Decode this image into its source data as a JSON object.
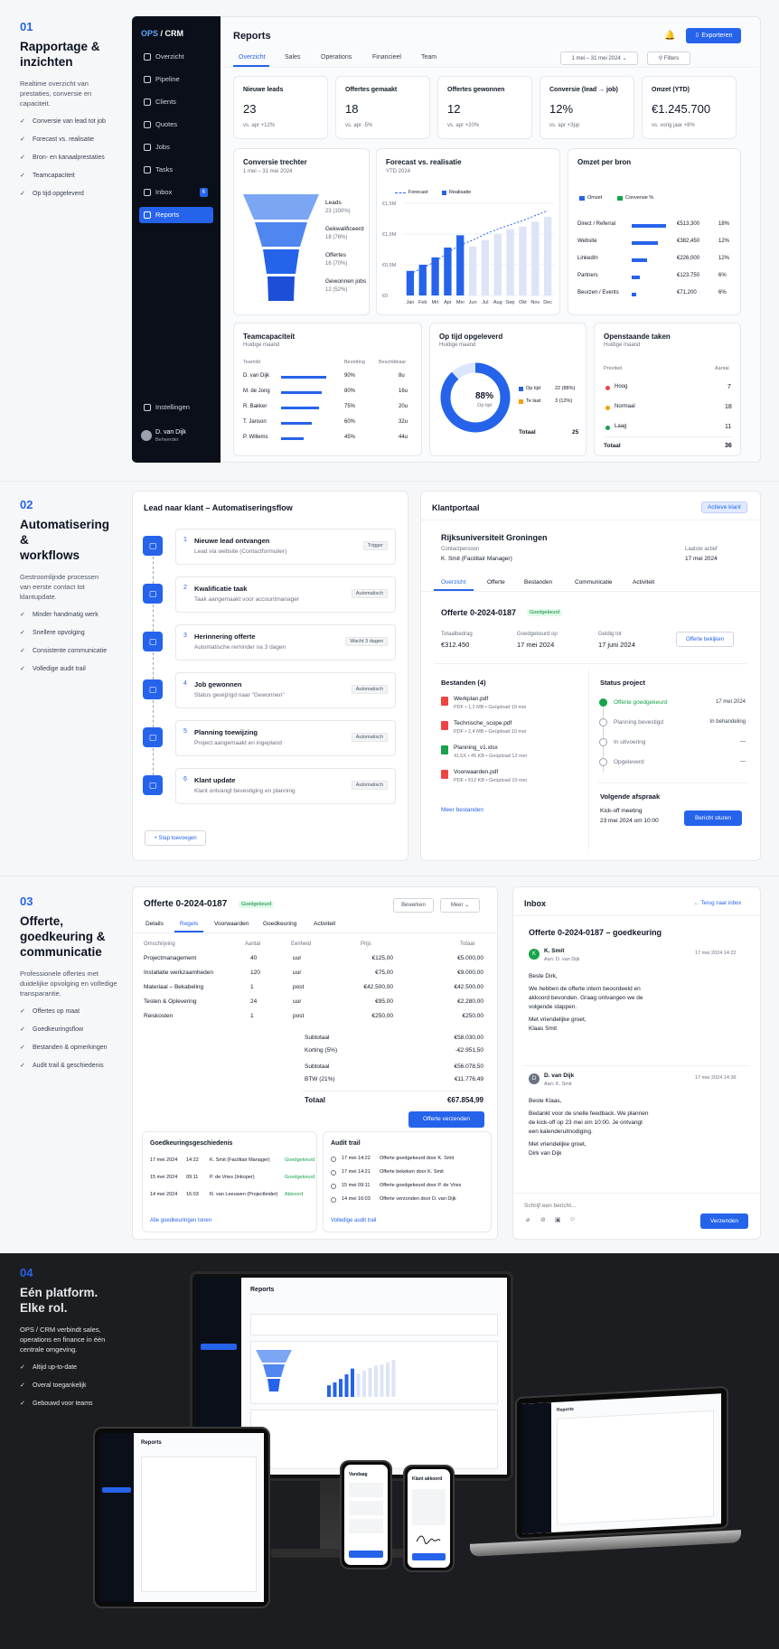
{
  "s1": {
    "num": "01",
    "title1": "Rapportage &",
    "title2": "inzichten",
    "desc": "Realtime overzicht van prestaties, conversie en capaciteit.",
    "checks": [
      "Conversie van lead tot job",
      "Forecast vs. realisatie",
      "Bron- en kanaalprestaties",
      "Teamcapaciteit",
      "Op tijd opgeleverd"
    ]
  },
  "s2": {
    "num": "02",
    "title1": "Automatisering &",
    "title2": "workflows",
    "desc": "Gestroomlijnde processen van eerste contact tot klantupdate.",
    "checks": [
      "Minder handmatig werk",
      "Snellere opvolging",
      "Consistente communicatie",
      "Volledige audit trail"
    ]
  },
  "s3": {
    "num": "03",
    "title1": "Offerte, goedkeuring &",
    "title2": "communicatie",
    "desc": "Professionele offertes met duidelijke opvolging en volledige transparantie.",
    "checks": [
      "Offertes op maat",
      "Goedkeuringsflow",
      "Bestanden & opmerkingen",
      "Audit trail & geschiedenis"
    ]
  },
  "s4": {
    "num": "04",
    "title1": "Eén platform.",
    "title2": "Elke rol.",
    "desc": "OPS / CRM verbindt sales, operations en finance in één centrale omgeving.",
    "checks": [
      "Altijd up-to-date",
      "Overal toegankelijk",
      "Gebouwd voor teams"
    ]
  },
  "app": {
    "logo": "OPS",
    "logo2": "/ CRM",
    "nav": [
      "Overzicht",
      "Pipeline",
      "Clients",
      "Quotes",
      "Jobs",
      "Tasks",
      "Inbox",
      "Reports"
    ],
    "inbox_badge": "6",
    "settings": "Instellingen",
    "user": "D. van Dijk",
    "role": "Beheerder"
  },
  "reports": {
    "title": "Reports",
    "export": "Exporteren",
    "tabs": [
      "Overzicht",
      "Sales",
      "Operations",
      "Financieel",
      "Team"
    ],
    "date": "1 mei – 31 mei 2024",
    "filters": "Filters",
    "kpis": [
      {
        "label": "Nieuwe leads",
        "value": "23",
        "delta": "vs. apr +12%"
      },
      {
        "label": "Offertes gemaakt",
        "value": "18",
        "delta": "vs. apr -5%"
      },
      {
        "label": "Offertes gewonnen",
        "value": "12",
        "delta": "vs. apr +20%"
      },
      {
        "label": "Conversie (lead → job)",
        "value": "12%",
        "delta": "vs. apr +3pp"
      },
      {
        "label": "Omzet (YTD)",
        "value": "€1.245.700",
        "delta": "vs. vorig jaar +8%"
      }
    ],
    "funnel": {
      "title": "Conversie trechter",
      "date": "1 mei – 31 mei 2024",
      "stages": [
        {
          "name": "Leads",
          "val": "23 (100%)"
        },
        {
          "name": "Gekwalificeerd",
          "val": "18 (78%)"
        },
        {
          "name": "Offertes",
          "val": "16 (70%)"
        },
        {
          "name": "Gewonnen jobs",
          "val": "12 (52%)"
        }
      ]
    },
    "forecast": {
      "title": "Forecast vs. realisatie",
      "sub": "YTD 2024",
      "legend": [
        "Forecast",
        "Realisatie"
      ],
      "yticks": [
        "€1,5M",
        "€1,0M",
        "€0,5M",
        "€0"
      ]
    },
    "omzet": {
      "title": "Omzet per bron",
      "legend": [
        "Omzet",
        "Conversie %"
      ],
      "rows": [
        {
          "name": "Direct / Referral",
          "amount": "€513,300",
          "pct": "18%",
          "frac": 1
        },
        {
          "name": "Website",
          "amount": "€382,450",
          "pct": "12%",
          "frac": 0.75
        },
        {
          "name": "LinkedIn",
          "amount": "€226,000",
          "pct": "12%",
          "frac": 0.44
        },
        {
          "name": "Partners",
          "amount": "€123,750",
          "pct": "6%",
          "frac": 0.24
        },
        {
          "name": "Beurzen / Events",
          "amount": "€71,200",
          "pct": "6%",
          "frac": 0.14
        }
      ]
    },
    "team": {
      "title": "Teamcapaciteit",
      "sub": "Huidige maand",
      "cols": [
        "Teamlid",
        "Bezetting",
        "Beschikbaar"
      ],
      "rows": [
        {
          "name": "D. van Dijk",
          "pct": "90%",
          "free": "8u",
          "frac": 0.9
        },
        {
          "name": "M. de Jong",
          "pct": "80%",
          "free": "16u",
          "frac": 0.8
        },
        {
          "name": "R. Bakker",
          "pct": "75%",
          "free": "20u",
          "frac": 0.75
        },
        {
          "name": "T. Janson",
          "pct": "60%",
          "free": "32u",
          "frac": 0.6
        },
        {
          "name": "P. Willems",
          "pct": "45%",
          "free": "44u",
          "frac": 0.45
        }
      ]
    },
    "ontime": {
      "title": "Op tijd opgeleverd",
      "sub": "Huidige maand",
      "pct": "88%",
      "label": "Op tijd",
      "rows": [
        {
          "name": "Op tijd",
          "val": "22 (88%)"
        },
        {
          "name": "Te laat",
          "val": "3 (12%)"
        }
      ],
      "total_label": "Totaal",
      "total": "25"
    },
    "tasks": {
      "title": "Openstaande taken",
      "sub": "Huidige maand",
      "cols": [
        "Prioriteit",
        "Aantal"
      ],
      "rows": [
        {
          "name": "Hoog",
          "val": "7"
        },
        {
          "name": "Normaal",
          "val": "18"
        },
        {
          "name": "Laag",
          "val": "11"
        }
      ],
      "total_label": "Totaal",
      "total": "36"
    }
  },
  "chart_data": {
    "type": "bar",
    "categories": [
      "Jan",
      "Feb",
      "Mrt",
      "Apr",
      "Mei",
      "Jun",
      "Jul",
      "Aug",
      "Sep",
      "Okt",
      "Nov",
      "Dec"
    ],
    "series": [
      {
        "name": "Realisatie",
        "values": [
          0.4,
          0.5,
          0.62,
          0.78,
          0.98,
          0.8,
          0.9,
          1.0,
          1.08,
          1.12,
          1.2,
          1.28
        ]
      },
      {
        "name": "Forecast",
        "values": [
          0.35,
          0.45,
          0.55,
          0.7,
          0.82,
          0.9,
          1.0,
          1.08,
          1.15,
          1.22,
          1.3,
          1.38
        ]
      }
    ],
    "title": "Forecast vs. realisatie",
    "ylim": [
      0,
      1.5
    ],
    "ylabel": ""
  },
  "flow": {
    "title": "Lead naar klant – Automatiseringsflow",
    "steps": [
      {
        "n": "1",
        "title": "Nieuwe lead ontvangen",
        "sub": "Lead via website (Contactformulier)",
        "tag": "Trigger"
      },
      {
        "n": "2",
        "title": "Kwalificatie taak",
        "sub": "Taak aangemaakt voor accountmanager",
        "tag": "Automatisch"
      },
      {
        "n": "3",
        "title": "Herinnering offerte",
        "sub": "Automatische reminder na 3 dagen",
        "tag": "Wacht 3 dagen"
      },
      {
        "n": "4",
        "title": "Job gewonnen",
        "sub": "Status gewijzigd naar \"Gewonnen\"",
        "tag": "Automatisch"
      },
      {
        "n": "5",
        "title": "Planning toewijzing",
        "sub": "Project aangemaakt en ingepland",
        "tag": "Automatisch"
      },
      {
        "n": "6",
        "title": "Klant update",
        "sub": "Klant ontvangt bevestiging en planning",
        "tag": "Automatisch"
      }
    ],
    "add": "+ Stap toevoegen"
  },
  "portal": {
    "title": "Klantportaal",
    "badge": "Actieve klant",
    "client": "Rijksuniversiteit Groningen",
    "contact_label": "Contactpersoon",
    "contact": "K. Smit (Facilitair Manager)",
    "last_label": "Laatste actief",
    "last": "17 mei 2024",
    "tabs": [
      "Overzicht",
      "Offerte",
      "Bestanden",
      "Communicatie",
      "Activiteit"
    ],
    "quote": "Offerte 0-2024-0187",
    "quote_badge": "Goedgekeurd",
    "fields": [
      {
        "label": "Totaalbedrag",
        "value": "€312.450"
      },
      {
        "label": "Goedgekeurd op",
        "value": "17 mei 2024"
      },
      {
        "label": "Geldig tot",
        "value": "17 juni 2024"
      }
    ],
    "view": "Offerte bekijken",
    "files_title": "Bestanden (4)",
    "files": [
      {
        "name": "Werkplan.pdf",
        "meta": "PDF • 1,2 MB • Geüpload 10 mei",
        "c": "#ef4444"
      },
      {
        "name": "Technische_scope.pdf",
        "meta": "PDF • 2,4 MB • Geüpload 10 mei",
        "c": "#ef4444"
      },
      {
        "name": "Planning_v1.xlsx",
        "meta": "XLSX • 45 KB • Geüpload 12 mei",
        "c": "#16a34a"
      },
      {
        "name": "Voorwaarden.pdf",
        "meta": "PDF • 512 KB • Geüpload 10 mei",
        "c": "#ef4444"
      }
    ],
    "more": "Meer bestanden",
    "status_title": "Status project",
    "status": [
      {
        "name": "Offerte goedgekeurd",
        "val": "17 mei 2024"
      },
      {
        "name": "Planning bevestigd",
        "val": "In behandeling"
      },
      {
        "name": "In uitvoering",
        "val": "—"
      },
      {
        "name": "Opgeleverd",
        "val": "—"
      }
    ],
    "next_title": "Volgende afspraak",
    "next_name": "Kick-off meeting",
    "next_date": "23 mei 2024 om 10:00",
    "send": "Bericht sturen"
  },
  "quote": {
    "title": "Offerte 0-2024-0187",
    "badge": "Goedgekeurd",
    "edit": "Bewerken",
    "more": "Meer",
    "tabs": [
      "Details",
      "Regels",
      "Voorwaarden",
      "Goedkeuring",
      "Activiteit"
    ],
    "cols": [
      "Omschrijving",
      "Aantal",
      "Eenheid",
      "Prijs",
      "Totaal"
    ],
    "rows": [
      [
        "Projectmanagement",
        "40",
        "uur",
        "€125,00",
        "€5.000,00"
      ],
      [
        "Installatie werkzaamheden",
        "120",
        "uur",
        "€75,00",
        "€9.000,00"
      ],
      [
        "Materiaal – Bekabeling",
        "1",
        "post",
        "€42.500,00",
        "€42.500,00"
      ],
      [
        "Testen & Oplevering",
        "24",
        "uur",
        "€95,00",
        "€2.280,00"
      ],
      [
        "Reiskosten",
        "1",
        "post",
        "€250,00",
        "€250,00"
      ]
    ],
    "sums": [
      [
        "Subtotaal",
        "€58.030,00"
      ],
      [
        "Korting (5%)",
        "-€2.951,50"
      ],
      [
        "Subtotaal",
        "€56.078,50"
      ],
      [
        "BTW (21%)",
        "€11.776,49"
      ]
    ],
    "total_label": "Totaal",
    "total": "€67.854,99",
    "send": "Offerte verzenden",
    "hist_title": "Goedkeuringsgeschiedenis",
    "hist": [
      [
        "17 mei 2024",
        "14:22",
        "K. Smit (Facilitair Manager)",
        "Goedgekeurd"
      ],
      [
        "15 mei 2024",
        "09:11",
        "P. de Vries (Inkoper)",
        "Goedgekeurd"
      ],
      [
        "14 mei 2024",
        "16:03",
        "R. van Leeuwen (Projectleider)",
        "Akkoord"
      ]
    ],
    "hist_link": "Alle goedkeuringen tonen",
    "audit_title": "Audit trail",
    "audit": [
      [
        "17 mei 14:22",
        "Offerte goedgekeurd door K. Smit"
      ],
      [
        "17 mei 14:21",
        "Offerte bekeken door K. Smit"
      ],
      [
        "15 mei 09:11",
        "Offerte goedgekeurd door P. de Vries"
      ],
      [
        "14 mei 16:03",
        "Offerte verzonden door D. van Dijk"
      ]
    ],
    "audit_link": "Volledige audit trail"
  },
  "inbox": {
    "title": "Inbox",
    "back": "← Terug naar inbox",
    "subject": "Offerte 0-2024-0187 – goedkeuring",
    "m1": {
      "from": "K. Smit",
      "to": "Aan: D. van Dijk",
      "date": "17 mei 2024 14:22",
      "body": [
        "Beste Dirk,",
        "We hebben de offerte intern beoordeeld en",
        "akkoord bevonden. Graag ontvangen we de",
        "volgende stappen.",
        "Met vriendelijke groet,",
        "Klaas Smit"
      ]
    },
    "m2": {
      "from": "D. van Dijk",
      "to": "Aan: K. Smit",
      "date": "17 mei 2024 14:36",
      "body": [
        "Beste Klaas,",
        "Bedankt voor de snelle feedback. We plannen",
        "de kick-off op 23 mei om 10:00. Je ontvangt",
        "een kalenderuitnodiging.",
        "Met vriendelijke groet,",
        "Dirk van Dijk"
      ]
    },
    "placeholder": "Schrijf een bericht...",
    "send": "Verzenden"
  },
  "devices": {
    "monitor_title": "Reports",
    "tablet_title": "Reports",
    "laptop_title": "Reports",
    "phone1": "Vandaag",
    "phone2": "Klant akkoord"
  }
}
